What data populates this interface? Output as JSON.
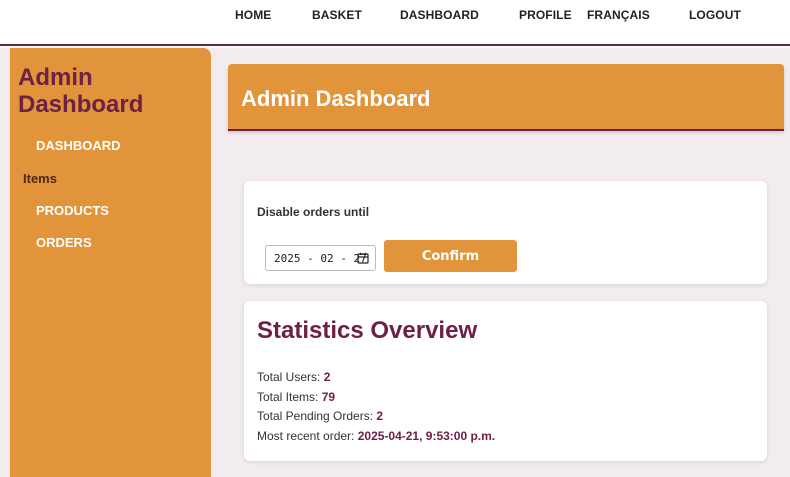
{
  "nav": {
    "home": "HOME",
    "basket": "BASKET",
    "dashboard": "DASHBOARD",
    "profile": "PROFILE",
    "language": "FRANÇAIS",
    "logout": "LOGOUT"
  },
  "sidebar": {
    "title_line1": "Admin",
    "title_line2": "Dashboard",
    "dashboard_link": "DASHBOARD",
    "section_items": "Items",
    "products_link": "PRODUCTS",
    "orders_link": "ORDERS"
  },
  "header": {
    "title": "Admin Dashboard"
  },
  "disable_orders": {
    "label": "Disable orders until",
    "date_value": "2025 - 02 - 27",
    "confirm_label": "Confirm"
  },
  "stats": {
    "title": "Statistics Overview",
    "total_users_label": "Total Users:",
    "total_users": "2",
    "total_items_label": "Total Items:",
    "total_items": "79",
    "pending_orders_label": "Total Pending Orders:",
    "pending_orders": "2",
    "recent_order_label": "Most recent order:",
    "recent_order": "2025-04-21, 9:53:00 p.m."
  },
  "colors": {
    "accent_orange": "#e2943b",
    "brand_maroon": "#6e2046",
    "page_bg": "#f2ecee"
  }
}
